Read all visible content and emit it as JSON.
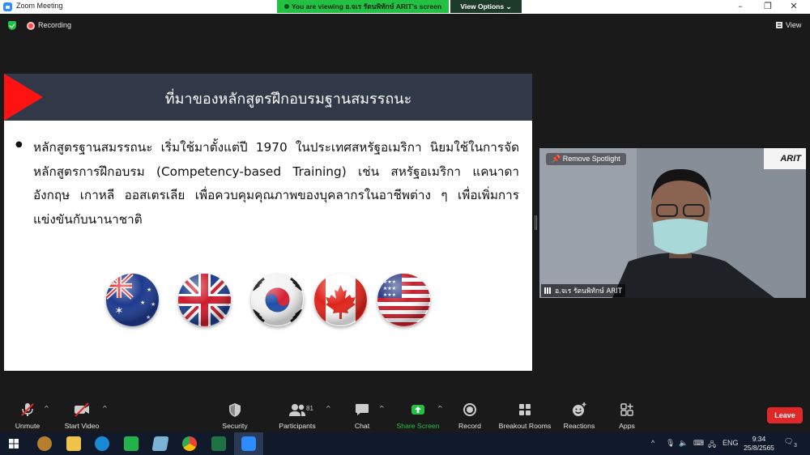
{
  "window": {
    "title": "Zoom Meeting"
  },
  "share_banner": {
    "text": "You are viewing อ.จเร รัตนพิทักษ์  ARIT's screen",
    "view_options": "View Options"
  },
  "status": {
    "recording": "Recording",
    "view": "View"
  },
  "slide": {
    "title": "ที่มาของหลักสูตรฝึกอบรมฐานสมรรถนะ",
    "bullet": "หลักสูตรฐานสมรรถนะ เริ่มใช้มาตั้งแต่ปี 1970 ในประเทศสหรัฐอเมริกา นิยมใช้ในการจัดหลักสูตรการฝึกอบรม (Competency-based Training) เช่น สหรัฐอเมริกา แคนาดา อังกฤษ เกาหลี ออสเตรเลีย เพื่อควบคุมคุณภาพของบุคลากรในอาชีพต่าง ๆ เพื่อเพิ่มการแข่งขันกับนานาชาติ",
    "flags": [
      "australia-flag",
      "uk-flag",
      "korea-flag",
      "canada-flag",
      "usa-flag"
    ],
    "colors": {
      "header": "#313949",
      "accent": "#ff1212"
    }
  },
  "video": {
    "remove_spotlight": "Remove Spotlight",
    "logo": "ARIT",
    "participant_name": "อ.จเร รัตนพิทักษ์  ARIT"
  },
  "toolbar": {
    "unmute": "Unmute",
    "start_video": "Start Video",
    "security": "Security",
    "participants": "Participants",
    "participants_count": "81",
    "chat": "Chat",
    "share_screen": "Share Screen",
    "record": "Record",
    "breakout_rooms": "Breakout Rooms",
    "reactions": "Reactions",
    "apps": "Apps",
    "leave": "Leave",
    "colors": {
      "share": "#23c043",
      "leave": "#e02828"
    }
  },
  "taskbar": {
    "language": "ENG",
    "time": "9:34",
    "date": "25/8/2565",
    "notifications": "3"
  }
}
